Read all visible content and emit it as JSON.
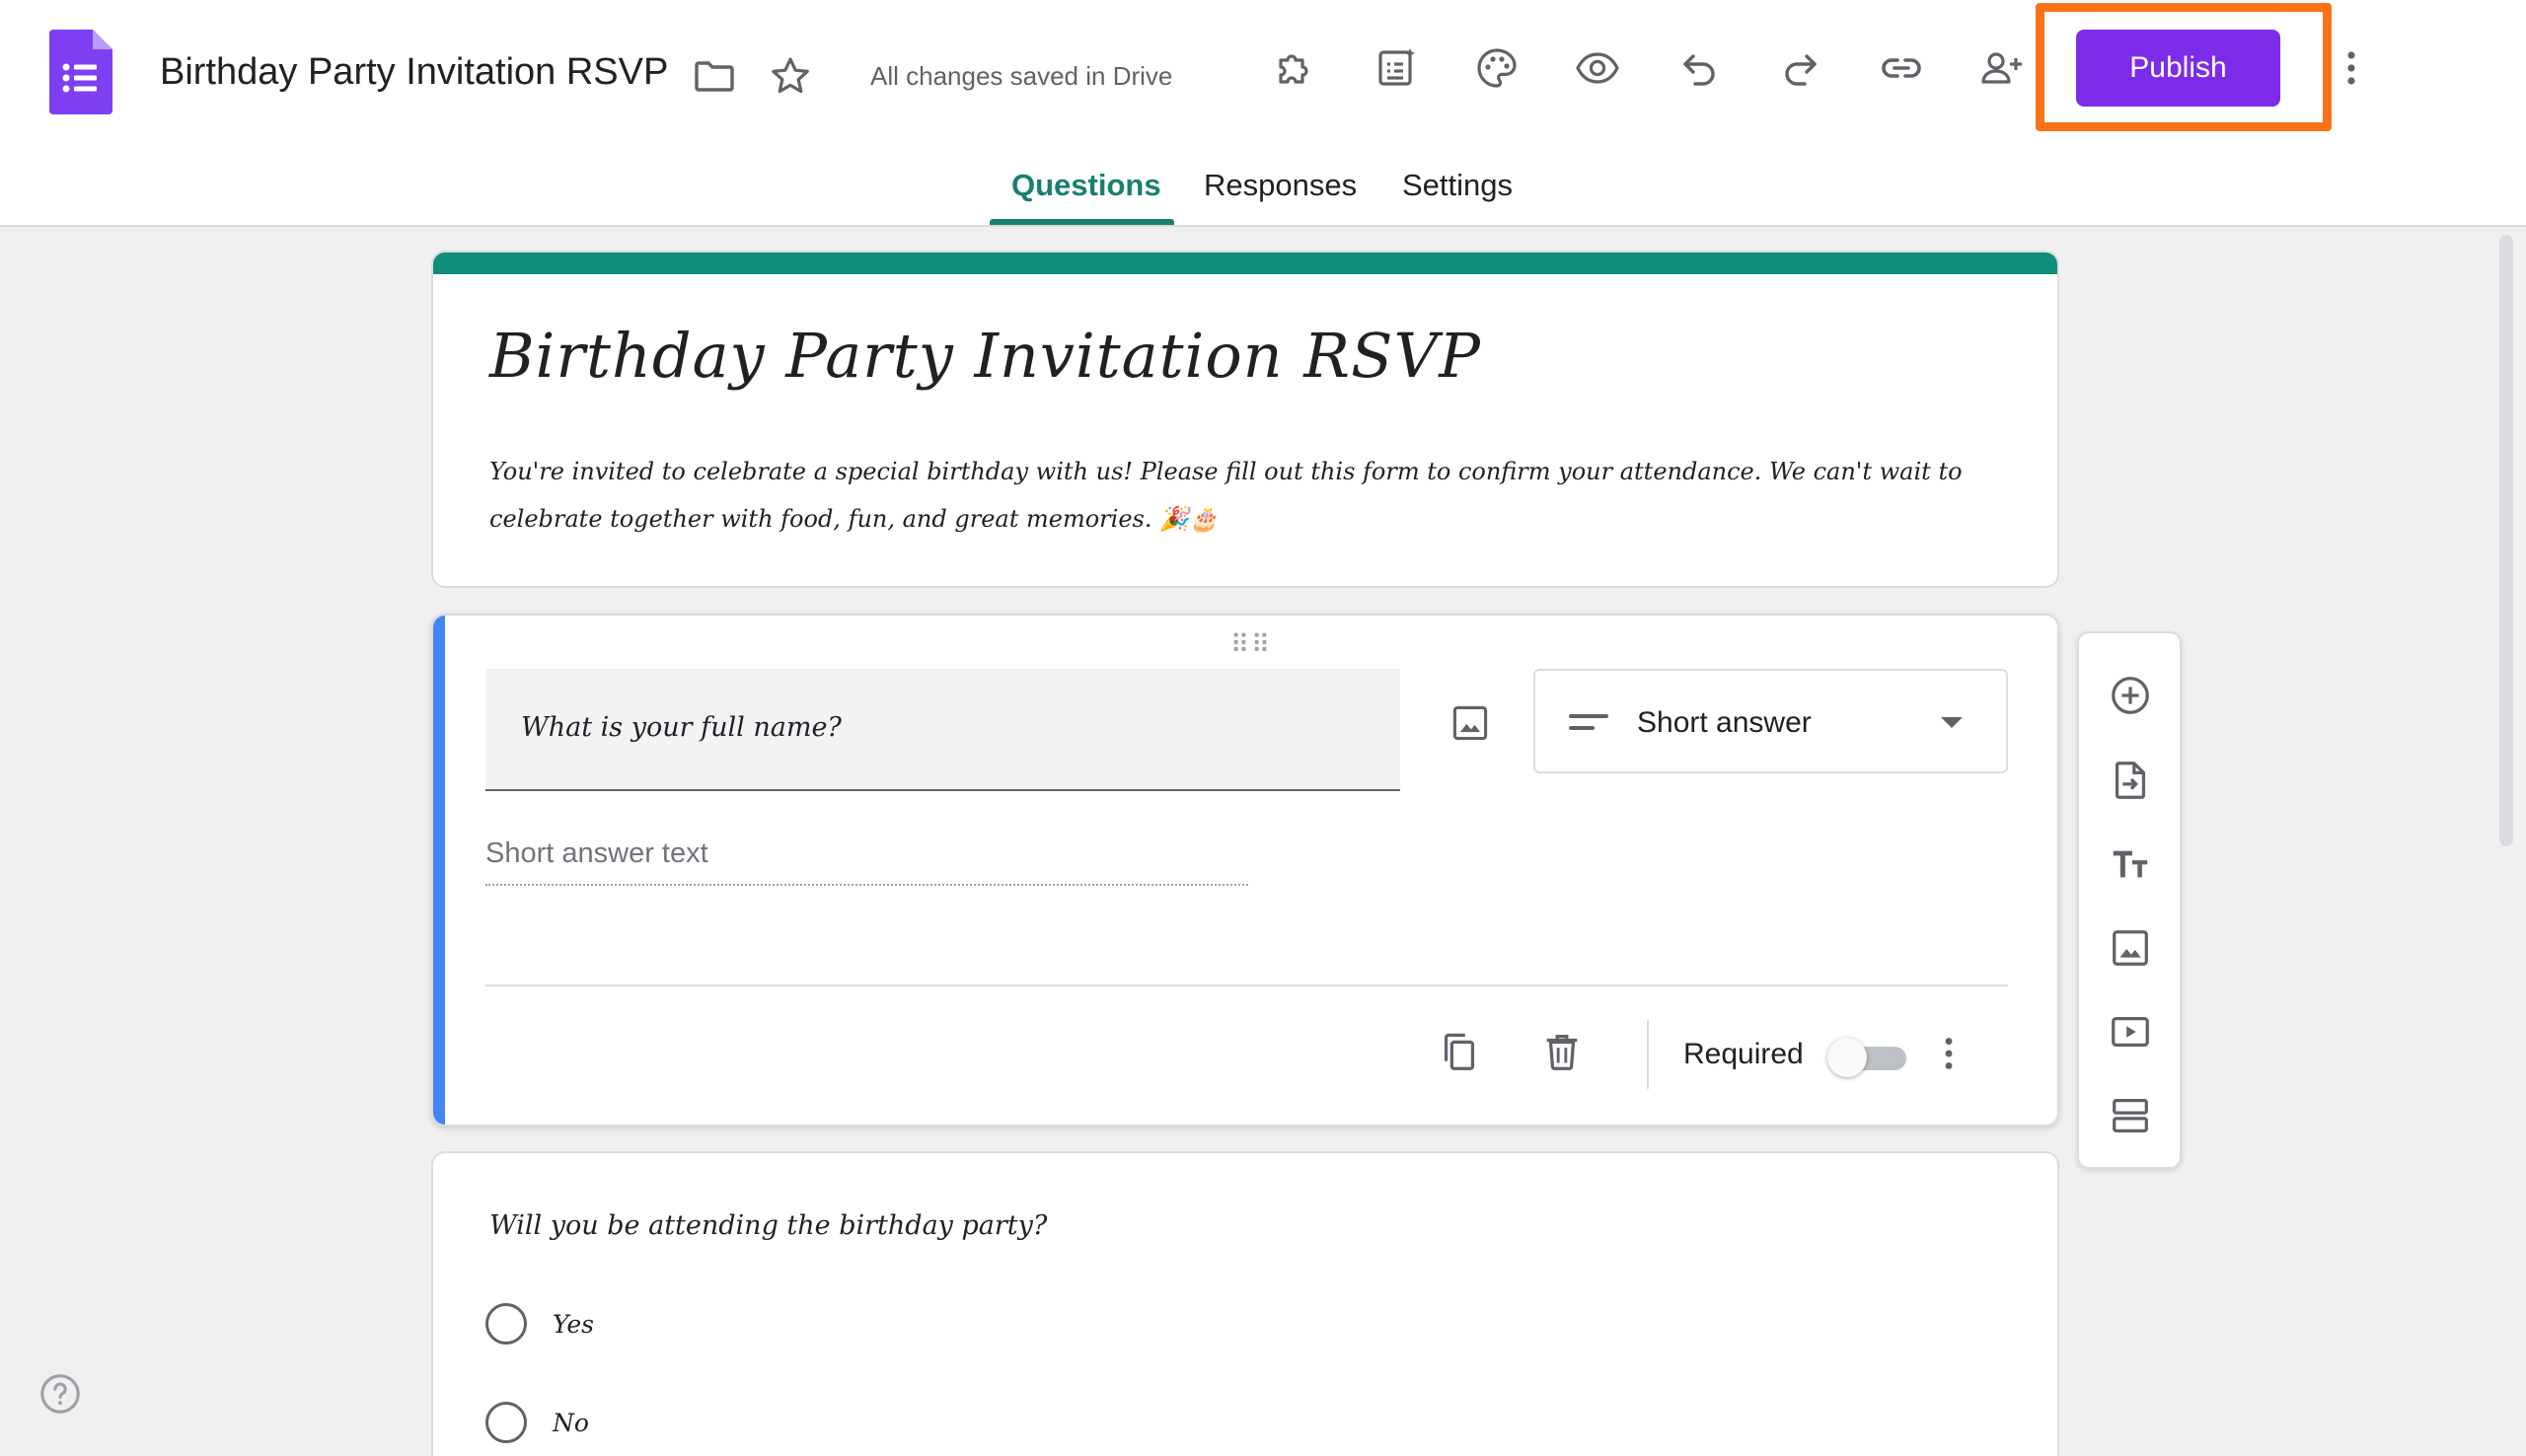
{
  "header": {
    "doc_title": "Birthday Party Invitation RSVP",
    "save_status": "All changes saved in Drive",
    "publish_label": "Publish",
    "icons": [
      "forms-logo-icon",
      "folder-icon",
      "star-icon",
      "addon-puzzle-icon",
      "form-sparkle-icon",
      "palette-icon",
      "preview-eye-icon",
      "undo-icon",
      "redo-icon",
      "link-icon",
      "add-collaborator-icon",
      "more-vert-icon"
    ]
  },
  "tabs": [
    {
      "label": "Questions",
      "active": true
    },
    {
      "label": "Responses",
      "active": false
    },
    {
      "label": "Settings",
      "active": false
    }
  ],
  "form": {
    "title": "Birthday Party Invitation RSVP",
    "description": "You're invited to celebrate a special birthday with us! Please fill out this form to confirm your attendance. We can't wait to celebrate together with food, fun, and great memories. 🎉🎂"
  },
  "question1": {
    "text": "What is your full name?",
    "type_label": "Short answer",
    "answer_placeholder": "Short answer text",
    "required_label": "Required",
    "required": false
  },
  "question2": {
    "text": "Will you be attending the birthday party?",
    "options": [
      "Yes",
      "No"
    ]
  },
  "side_toolbar": [
    "add-question-icon",
    "import-questions-icon",
    "add-title-icon",
    "add-image-icon",
    "add-video-icon",
    "add-section-icon"
  ],
  "colors": {
    "accent": "#7c2ce8",
    "highlight": "#f97316",
    "theme": "#0f8f7a",
    "active_tab": "#1a7f6e",
    "question_accent": "#4285f4"
  }
}
